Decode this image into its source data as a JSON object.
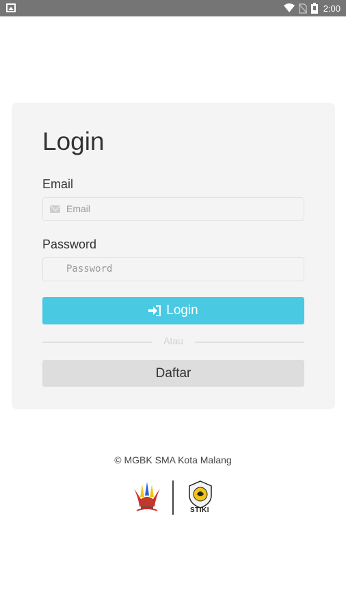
{
  "status_bar": {
    "time": "2:00",
    "icons": [
      "image-icon",
      "wifi-icon",
      "no-sim-icon",
      "battery-icon"
    ]
  },
  "login_card": {
    "title": "Login",
    "email_label": "Email",
    "email_placeholder": "Email",
    "email_value": "",
    "password_label": "Password",
    "password_placeholder": "Password",
    "password_value": "",
    "login_button": "Login",
    "divider_text": "Atau",
    "register_button": "Daftar"
  },
  "footer": {
    "copyright": "© MGBK SMA Kota Malang",
    "logo_right_text": "STIKI"
  },
  "colors": {
    "status_bar": "#757575",
    "card_bg": "#f4f4f4",
    "login_button": "#4ac9e3",
    "register_button": "#dddddd"
  }
}
